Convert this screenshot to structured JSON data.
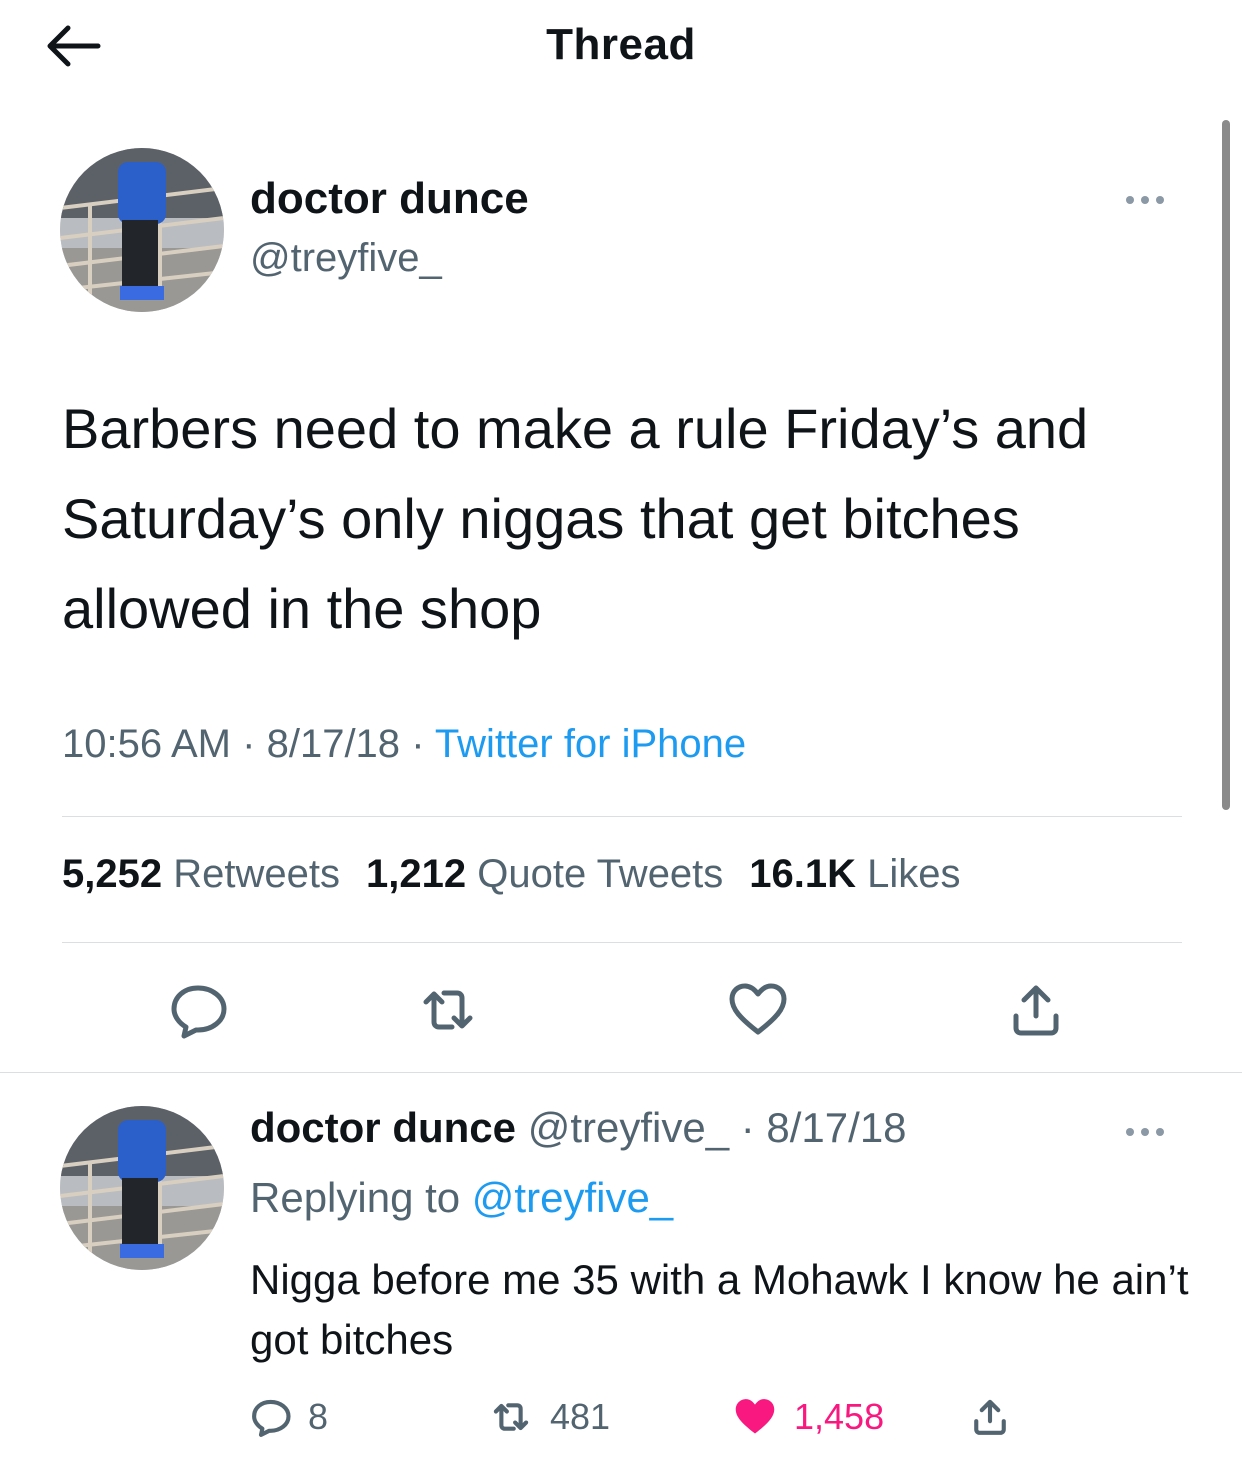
{
  "header": {
    "title": "Thread",
    "back_icon": "arrow-left-icon"
  },
  "tweet": {
    "name": "doctor dunce",
    "handle": "@treyfive_",
    "text": "Barbers need to make a rule Friday’s and Saturday’s only niggas that get bitches allowed in the shop",
    "time": "10:56 AM",
    "sep": "·",
    "date": "8/17/18",
    "source": "Twitter for iPhone",
    "stats": {
      "retweets_count": "5,252",
      "retweets_label": "Retweets",
      "quotes_count": "1,212",
      "quotes_label": "Quote Tweets",
      "likes_count": "16.1K",
      "likes_label": "Likes"
    },
    "actions": [
      "reply-icon",
      "retweet-icon",
      "heart-icon",
      "share-icon"
    ]
  },
  "reply": {
    "name": "doctor dunce",
    "handle": "@treyfive_",
    "sep": "·",
    "date": "8/17/18",
    "replying_label": "Replying to",
    "replying_handle": "@treyfive_",
    "text": "Nigga before me 35 with a Mohawk I know he ain’t got bitches",
    "counts": {
      "replies": "8",
      "retweets": "481",
      "likes": "1,458"
    }
  },
  "colors": {
    "link": "#1d9bf0",
    "muted": "#536471",
    "like": "#f91880",
    "text": "#0f1419"
  }
}
